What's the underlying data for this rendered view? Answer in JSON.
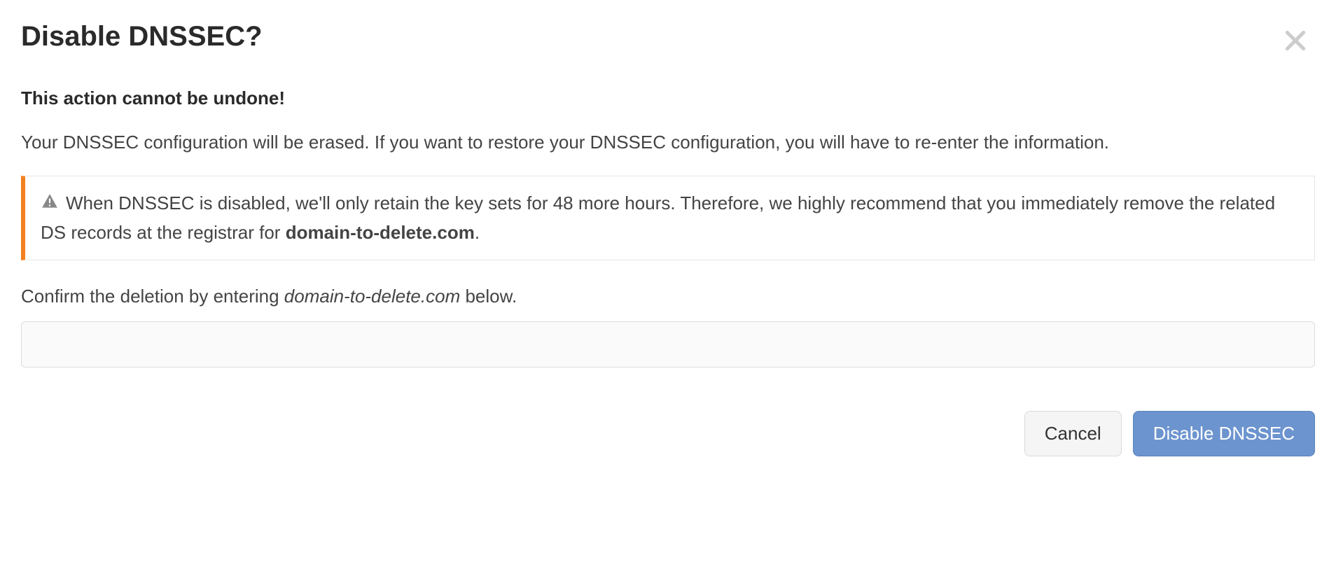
{
  "dialog": {
    "title": "Disable DNSSEC?",
    "warning_heading": "This action cannot be undone!",
    "description": "Your DNSSEC configuration will be erased. If you want to restore your DNSSEC configuration, you will have to re-enter the information.",
    "notice": {
      "text_before_domain": "When DNSSEC is disabled, we'll only retain the key sets for 48 more hours. Therefore, we highly recommend that you immediately remove the related DS records at the registrar for ",
      "domain": "domain-to-delete.com",
      "text_after_domain": "."
    },
    "confirm_prompt": {
      "prefix": "Confirm the deletion by entering ",
      "domain": "domain-to-delete.com",
      "suffix": " below."
    },
    "input_value": "",
    "buttons": {
      "cancel": "Cancel",
      "confirm": "Disable DNSSEC"
    }
  }
}
